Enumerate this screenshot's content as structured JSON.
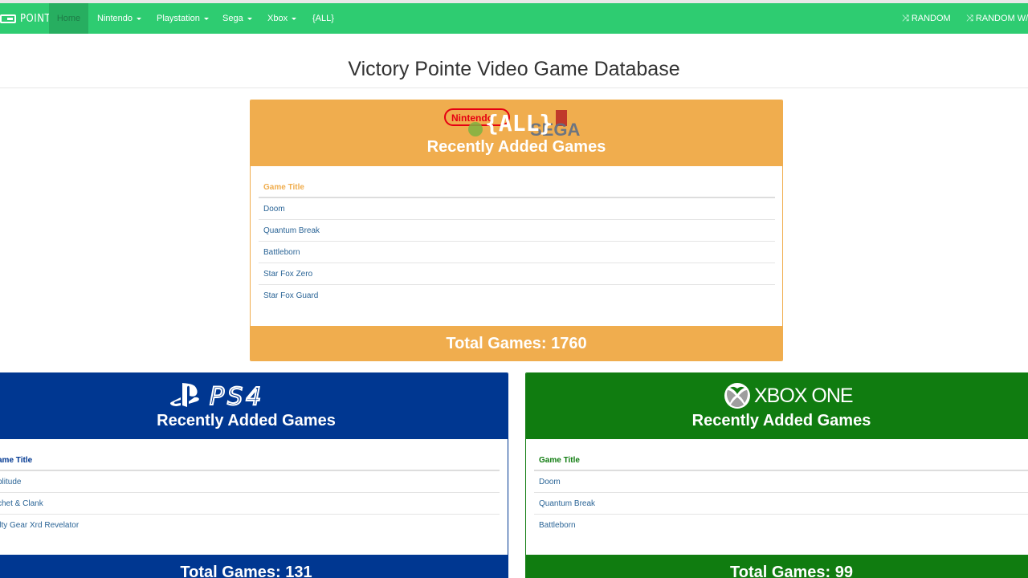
{
  "brand": {
    "text": "POINTE"
  },
  "nav": {
    "home": "Home",
    "nintendo": "Nintendo",
    "playstation": "Playstation",
    "sega": "Sega",
    "xbox": "Xbox",
    "all": "{ALL}",
    "random": "RANDOM",
    "random_with": "RANDOM W/ C"
  },
  "page": {
    "title": "Victory Pointe Video Game Database"
  },
  "panels": {
    "all": {
      "logo_text": "{ALL}",
      "logo_nintendo": "Nintendo",
      "logo_sega": "SEGA",
      "heading": "Recently Added Games",
      "column_header": "Game Title",
      "games": [
        "Doom",
        "Quantum Break",
        "Battleborn",
        "Star Fox Zero",
        "Star Fox Guard"
      ],
      "total": "Total Games: 1760",
      "color": "#f0ad4e"
    },
    "ps4": {
      "logo_text": "PS4",
      "heading": "Recently Added Games",
      "column_header": "ame Title",
      "games": [
        "plitude",
        "chet & Clank",
        "ilty Gear Xrd Revelator"
      ],
      "total": "Total Games: 131",
      "color": "#003791"
    },
    "xbox": {
      "logo_text": "XBOX ONE",
      "heading": "Recently Added Games",
      "column_header": "Game Title",
      "games": [
        "Doom",
        "Quantum Break",
        "Battleborn"
      ],
      "total": "Total Games: 99",
      "color": "#107c10"
    }
  },
  "colors": {
    "navbar": "#2ecc71",
    "link": "#2a6496"
  },
  "icons": {
    "brand": "controller-icon",
    "random": "shuffle-icon",
    "dropdown": "caret-down-icon"
  }
}
